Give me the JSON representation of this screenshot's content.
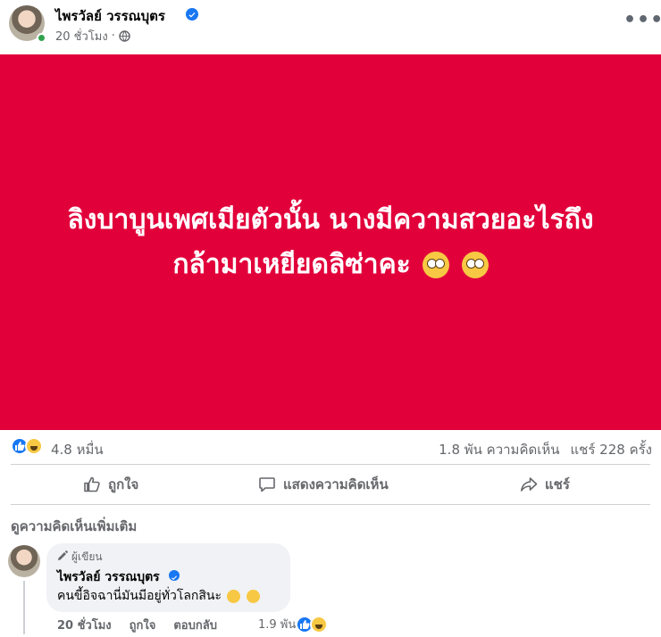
{
  "post": {
    "author_name": "ไพรวัลย์ วรรณบุตร",
    "time": "20 ชั่วโมง",
    "separator": "·",
    "text_line1": "ลิงบาบูนเพศเมียตัวนั้น นางมีความสวยอะไรถึง",
    "text_line2": "กล้ามาเหยียดลิซ่าคะ",
    "background_color": "#e2003b",
    "more_icon": "•••"
  },
  "stats": {
    "reactions": "4.8 หมื่น",
    "comments": "1.8 พัน ความคิดเห็น",
    "shares": "แชร์ 228 ครั้ง"
  },
  "actions": {
    "like": "ถูกใจ",
    "comment": "แสดงความคิดเห็น",
    "share": "แชร์"
  },
  "more_comments": "ดูความคิดเห็นเพิ่มเติม",
  "comment": {
    "author_tag": "ผู้เขียน",
    "author_name": "ไพรวัลย์ วรรณบุตร",
    "text": "คนขี้อิจฉานี่มันมีอยู่ทั่วโลกสินะ",
    "time": "20 ชั่วโมง",
    "like": "ถูกใจ",
    "reply": "ตอบกลับ",
    "reaction_count": "1.9 พัน"
  }
}
